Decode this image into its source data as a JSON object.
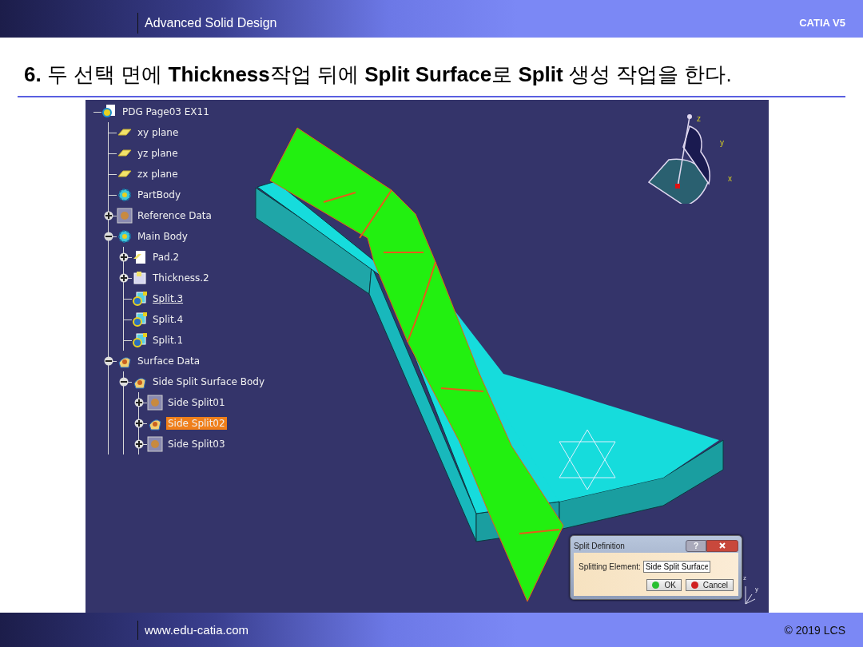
{
  "header": {
    "course": "Advanced Solid Design",
    "product": "CATIA V5"
  },
  "heading": "**6.** 두 선택 면에 **Thickness**작업 뒤에 **Split Surface**로 **Split** 생성 작업을 한다.",
  "viewport": {
    "tree": [
      {
        "label": "PDG Page03 EX11",
        "kind": "product",
        "selected": false,
        "current": false,
        "children": [
          {
            "label": "xy plane",
            "kind": "plane",
            "selected": false,
            "current": false
          },
          {
            "label": "yz plane",
            "kind": "plane",
            "selected": false,
            "current": false
          },
          {
            "label": "zx plane",
            "kind": "plane",
            "selected": false,
            "current": false
          },
          {
            "label": "PartBody",
            "kind": "body",
            "selected": false,
            "current": false
          },
          {
            "label": "Reference Data",
            "kind": "reference",
            "expanded": false,
            "selected": false,
            "current": false
          },
          {
            "label": "Main Body",
            "kind": "body",
            "expanded": true,
            "selected": false,
            "current": false,
            "children": [
              {
                "label": "Pad.2",
                "kind": "pad",
                "expanded": false,
                "selected": false,
                "current": false
              },
              {
                "label": "Thickness.2",
                "kind": "thickness",
                "expanded": false,
                "selected": false,
                "current": false
              },
              {
                "label": "Split.3",
                "kind": "split",
                "selected": false,
                "current": true
              },
              {
                "label": "Split.4",
                "kind": "split",
                "selected": false,
                "current": false
              },
              {
                "label": "Split.1",
                "kind": "split",
                "selected": false,
                "current": false
              }
            ]
          },
          {
            "label": "Surface Data",
            "kind": "surface",
            "expanded": true,
            "selected": false,
            "current": false,
            "children": [
              {
                "label": "Side Split Surface Body",
                "kind": "surface",
                "expanded": true,
                "selected": false,
                "current": false,
                "children": [
                  {
                    "label": "Side Split01",
                    "kind": "reference",
                    "expanded": false,
                    "selected": false,
                    "current": false
                  },
                  {
                    "label": "Side Split02",
                    "kind": "surface",
                    "expanded": false,
                    "selected": true,
                    "current": false
                  },
                  {
                    "label": "Side Split03",
                    "kind": "reference",
                    "expanded": false,
                    "selected": false,
                    "current": false
                  }
                ]
              }
            ]
          }
        ]
      }
    ],
    "compass_labels": [
      "z",
      "y",
      "x"
    ],
    "triad_labels": [
      "z",
      "y"
    ],
    "dialog": {
      "title": "Split Definition",
      "help_button": "?",
      "field_label": "Splitting Element:",
      "field_value": "Side Split Surface",
      "buttons": [
        {
          "label": "OK",
          "kind": "ok"
        },
        {
          "label": "Cancel",
          "kind": "cancel"
        }
      ]
    }
  },
  "footer": {
    "website": "www.edu-catia.com",
    "copyright": "© 2019 LCS"
  }
}
